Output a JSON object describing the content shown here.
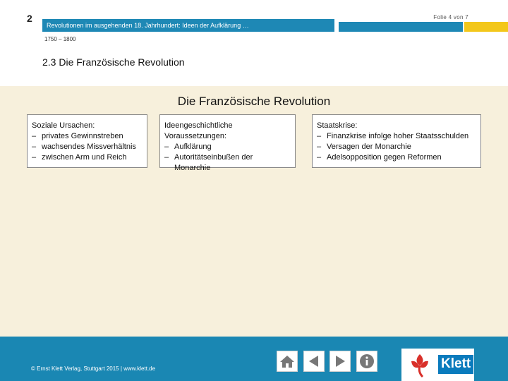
{
  "header": {
    "chapter_number": "2",
    "slide_counter": "Folie 4 von 7",
    "title": "Revolutionen im ausgehenden 18. Jahrhundert: Ideen der Aufklärung …",
    "period": "1750 – 1800",
    "section_title": "2.3 Die Französische Revolution"
  },
  "main": {
    "diagram_title": "Die Französische Revolution",
    "boxes": [
      {
        "heading": "Soziale Ursachen:",
        "items": [
          "privates Gewinnstreben",
          "wachsendes Missverhältnis",
          "zwischen Arm und Reich"
        ]
      },
      {
        "heading": "Ideengeschichtliche Voraussetzungen:",
        "items": [
          "Aufklärung",
          "Autoritätseinbußen der Monarchie"
        ]
      },
      {
        "heading": "Staatskrise:",
        "items": [
          "Finanzkrise infolge hoher Staatsschulden",
          "Versagen der Monarchie",
          "Adelsopposition gegen Reformen"
        ]
      }
    ]
  },
  "footer": {
    "copyright": "© Ernst Klett Verlag, Stuttgart 2015 | www.klett.de",
    "nav_icons": [
      "home-icon",
      "arrow-left-icon",
      "arrow-right-icon",
      "info-icon"
    ],
    "logo_text": "Klett"
  },
  "colors": {
    "brand_blue": "#1a87b3",
    "accent_yellow": "#f3c71b",
    "content_background": "#f7f0dc",
    "logo_red": "#d9302a"
  }
}
